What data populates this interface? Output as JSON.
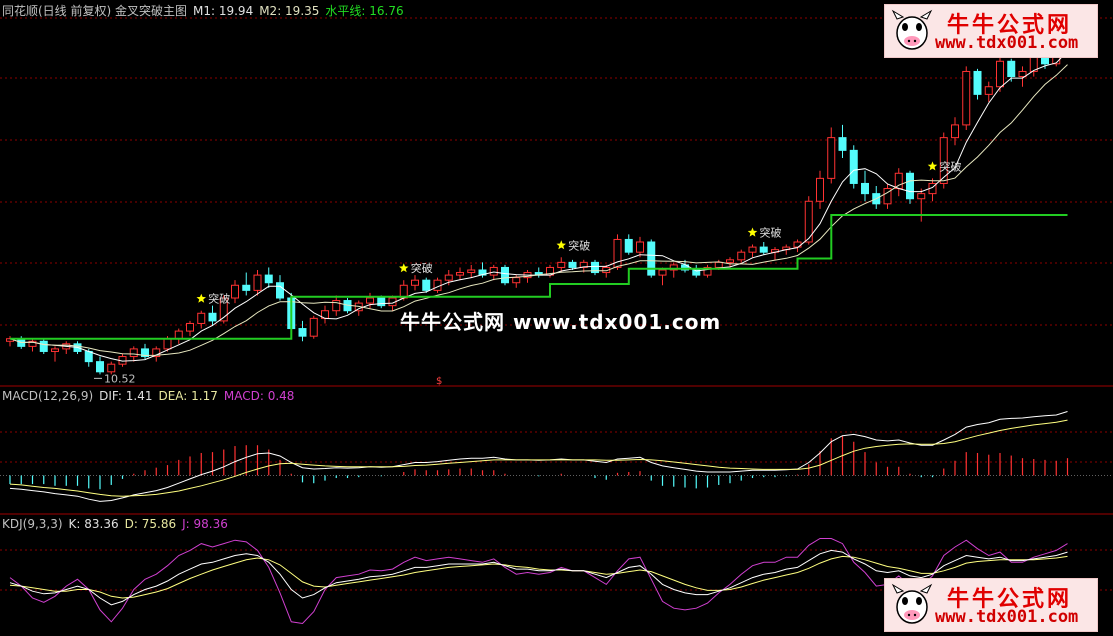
{
  "main_header": {
    "title": "同花顺(日线 前复权) 金叉突破主图",
    "m1": "M1: 19.94",
    "m2": "M2: 19.35",
    "level": "水平线: 16.76"
  },
  "macd_header": {
    "name": "MACD(12,26,9)",
    "dif": "DIF: 1.41",
    "dea": "DEA: 1.17",
    "macd": "MACD: 0.48"
  },
  "kdj_header": {
    "name": "KDJ(9,3,3)",
    "k": "K: 83.36",
    "d": "D: 75.86",
    "j": "J: 98.36"
  },
  "watermark": "牛牛公式网 www.tdx001.com",
  "logo": {
    "title": "牛牛公式网",
    "url": "www.tdx001.com"
  },
  "colors": {
    "up": "#ff3232",
    "down": "#54fcfc",
    "level": "#22cc22",
    "m1": "#ffffff",
    "m2": "#e8e8c0",
    "grid": "#8b0000",
    "dif": "#ffffff",
    "dea": "#ffff80",
    "j": "#d040d0",
    "star": "#ffff00"
  },
  "chart_data": [
    {
      "type": "candlestick",
      "low_label": "10.52",
      "signal_label": "突破",
      "signal_index": [
        17,
        35,
        49,
        66,
        82
      ],
      "ohlc": [
        [
          11.8,
          12.0,
          11.6,
          11.9
        ],
        [
          11.9,
          12.0,
          11.5,
          11.6
        ],
        [
          11.6,
          11.9,
          11.4,
          11.8
        ],
        [
          11.8,
          11.9,
          11.3,
          11.4
        ],
        [
          11.4,
          11.6,
          11.0,
          11.5
        ],
        [
          11.5,
          11.8,
          11.3,
          11.7
        ],
        [
          11.7,
          11.8,
          11.3,
          11.4
        ],
        [
          11.4,
          11.5,
          10.8,
          11.0
        ],
        [
          11.0,
          11.2,
          10.5,
          10.6
        ],
        [
          10.6,
          11.0,
          10.5,
          10.9
        ],
        [
          10.9,
          11.3,
          10.8,
          11.2
        ],
        [
          11.2,
          11.6,
          11.0,
          11.5
        ],
        [
          11.5,
          11.7,
          11.1,
          11.2
        ],
        [
          11.2,
          11.6,
          11.0,
          11.5
        ],
        [
          11.5,
          12.0,
          11.4,
          11.9
        ],
        [
          11.9,
          12.3,
          11.7,
          12.2
        ],
        [
          12.2,
          12.6,
          12.0,
          12.5
        ],
        [
          12.5,
          13.0,
          12.3,
          12.9
        ],
        [
          12.9,
          13.2,
          12.4,
          12.6
        ],
        [
          12.6,
          13.6,
          12.5,
          13.5
        ],
        [
          13.5,
          14.2,
          13.3,
          14.0
        ],
        [
          14.0,
          14.5,
          13.6,
          13.8
        ],
        [
          13.8,
          14.6,
          13.6,
          14.4
        ],
        [
          14.4,
          14.7,
          13.9,
          14.1
        ],
        [
          14.1,
          14.4,
          13.4,
          13.5
        ],
        [
          13.5,
          13.7,
          12.2,
          12.3
        ],
        [
          12.3,
          12.6,
          11.8,
          12.0
        ],
        [
          12.0,
          12.8,
          11.9,
          12.7
        ],
        [
          12.7,
          13.2,
          12.5,
          13.0
        ],
        [
          13.0,
          13.6,
          12.8,
          13.4
        ],
        [
          13.4,
          13.5,
          12.9,
          13.0
        ],
        [
          13.0,
          13.4,
          12.8,
          13.3
        ],
        [
          13.3,
          13.7,
          13.1,
          13.5
        ],
        [
          13.5,
          13.6,
          13.1,
          13.2
        ],
        [
          13.2,
          13.6,
          13.0,
          13.5
        ],
        [
          13.5,
          14.2,
          13.4,
          14.0
        ],
        [
          14.0,
          14.4,
          13.8,
          14.2
        ],
        [
          14.2,
          14.3,
          13.7,
          13.8
        ],
        [
          13.8,
          14.3,
          13.7,
          14.2
        ],
        [
          14.2,
          14.6,
          14.0,
          14.4
        ],
        [
          14.4,
          14.7,
          14.2,
          14.5
        ],
        [
          14.5,
          14.8,
          14.3,
          14.6
        ],
        [
          14.6,
          14.9,
          14.3,
          14.4
        ],
        [
          14.4,
          14.8,
          14.2,
          14.7
        ],
        [
          14.7,
          14.8,
          14.0,
          14.1
        ],
        [
          14.1,
          14.4,
          13.9,
          14.3
        ],
        [
          14.3,
          14.6,
          14.1,
          14.5
        ],
        [
          14.5,
          14.7,
          14.3,
          14.4
        ],
        [
          14.4,
          14.8,
          14.3,
          14.7
        ],
        [
          14.7,
          15.1,
          14.5,
          14.9
        ],
        [
          14.9,
          15.0,
          14.6,
          14.7
        ],
        [
          14.7,
          15.0,
          14.5,
          14.9
        ],
        [
          14.9,
          15.0,
          14.4,
          14.5
        ],
        [
          14.5,
          14.8,
          14.3,
          14.7
        ],
        [
          14.7,
          16.0,
          14.6,
          15.8
        ],
        [
          15.8,
          16.0,
          15.2,
          15.3
        ],
        [
          15.3,
          15.9,
          15.1,
          15.7
        ],
        [
          15.7,
          15.8,
          14.3,
          14.4
        ],
        [
          14.4,
          14.7,
          14.0,
          14.6
        ],
        [
          14.6,
          14.9,
          14.3,
          14.8
        ],
        [
          14.8,
          15.0,
          14.5,
          14.6
        ],
        [
          14.6,
          14.8,
          14.3,
          14.4
        ],
        [
          14.4,
          14.8,
          14.3,
          14.7
        ],
        [
          14.7,
          15.0,
          14.6,
          14.9
        ],
        [
          14.9,
          15.1,
          14.7,
          15.0
        ],
        [
          15.0,
          15.4,
          14.9,
          15.3
        ],
        [
          15.3,
          15.6,
          15.1,
          15.5
        ],
        [
          15.5,
          15.7,
          15.2,
          15.3
        ],
        [
          15.3,
          15.5,
          15.0,
          15.4
        ],
        [
          15.4,
          15.6,
          15.2,
          15.5
        ],
        [
          15.5,
          15.8,
          15.3,
          15.7
        ],
        [
          15.7,
          17.5,
          15.6,
          17.3
        ],
        [
          17.3,
          18.5,
          17.0,
          18.2
        ],
        [
          18.2,
          20.2,
          18.0,
          19.8
        ],
        [
          19.8,
          20.3,
          19.0,
          19.3
        ],
        [
          19.3,
          19.5,
          17.8,
          18.0
        ],
        [
          18.0,
          18.5,
          17.3,
          17.6
        ],
        [
          17.6,
          17.9,
          17.0,
          17.2
        ],
        [
          17.2,
          18.0,
          17.0,
          17.8
        ],
        [
          17.8,
          18.6,
          17.5,
          18.4
        ],
        [
          18.4,
          18.5,
          17.2,
          17.4
        ],
        [
          17.4,
          17.8,
          16.5,
          17.6
        ],
        [
          17.6,
          18.2,
          17.3,
          18.0
        ],
        [
          18.0,
          20.0,
          17.8,
          19.8
        ],
        [
          19.8,
          20.6,
          19.5,
          20.3
        ],
        [
          20.3,
          22.6,
          20.1,
          22.4
        ],
        [
          22.4,
          22.5,
          21.3,
          21.5
        ],
        [
          21.5,
          22.0,
          21.2,
          21.8
        ],
        [
          21.8,
          23.0,
          21.6,
          22.8
        ],
        [
          22.8,
          22.9,
          22.0,
          22.2
        ],
        [
          22.2,
          22.6,
          21.8,
          22.4
        ],
        [
          22.4,
          23.2,
          22.2,
          23.0
        ],
        [
          23.0,
          23.6,
          22.5,
          22.7
        ],
        [
          22.7,
          23.5,
          22.6,
          23.4
        ],
        [
          23.4,
          25.0,
          23.2,
          24.5
        ]
      ],
      "level_steps": [
        [
          0,
          11.9
        ],
        [
          25,
          13.55
        ],
        [
          48,
          14.05
        ],
        [
          55,
          14.65
        ],
        [
          70,
          15.05
        ],
        [
          73,
          16.76
        ]
      ],
      "ylim": [
        10.2,
        24.5
      ]
    },
    {
      "type": "macd",
      "dif": [
        -0.3,
        -0.32,
        -0.35,
        -0.38,
        -0.42,
        -0.45,
        -0.48,
        -0.55,
        -0.6,
        -0.58,
        -0.52,
        -0.45,
        -0.4,
        -0.35,
        -0.28,
        -0.18,
        -0.08,
        0.02,
        0.1,
        0.2,
        0.32,
        0.42,
        0.5,
        0.52,
        0.45,
        0.3,
        0.18,
        0.15,
        0.16,
        0.18,
        0.17,
        0.18,
        0.2,
        0.19,
        0.2,
        0.25,
        0.3,
        0.3,
        0.32,
        0.35,
        0.38,
        0.4,
        0.4,
        0.42,
        0.38,
        0.36,
        0.36,
        0.35,
        0.36,
        0.38,
        0.36,
        0.36,
        0.33,
        0.3,
        0.38,
        0.4,
        0.42,
        0.3,
        0.22,
        0.18,
        0.14,
        0.1,
        0.08,
        0.08,
        0.08,
        0.1,
        0.12,
        0.12,
        0.12,
        0.13,
        0.15,
        0.3,
        0.52,
        0.78,
        0.92,
        0.95,
        0.9,
        0.82,
        0.8,
        0.82,
        0.75,
        0.7,
        0.7,
        0.82,
        0.95,
        1.12,
        1.18,
        1.22,
        1.3,
        1.32,
        1.33,
        1.36,
        1.38,
        1.4,
        1.48
      ],
      "dea": [
        -0.2,
        -0.22,
        -0.25,
        -0.28,
        -0.3,
        -0.33,
        -0.36,
        -0.4,
        -0.44,
        -0.47,
        -0.48,
        -0.47,
        -0.46,
        -0.44,
        -0.4,
        -0.36,
        -0.3,
        -0.24,
        -0.17,
        -0.1,
        -0.02,
        0.07,
        0.15,
        0.22,
        0.27,
        0.28,
        0.26,
        0.24,
        0.22,
        0.21,
        0.2,
        0.2,
        0.2,
        0.2,
        0.2,
        0.21,
        0.23,
        0.24,
        0.26,
        0.28,
        0.3,
        0.32,
        0.34,
        0.36,
        0.36,
        0.36,
        0.36,
        0.36,
        0.36,
        0.36,
        0.36,
        0.36,
        0.36,
        0.35,
        0.35,
        0.36,
        0.37,
        0.36,
        0.34,
        0.31,
        0.28,
        0.25,
        0.22,
        0.19,
        0.17,
        0.16,
        0.15,
        0.14,
        0.14,
        0.14,
        0.14,
        0.17,
        0.24,
        0.35,
        0.46,
        0.56,
        0.63,
        0.67,
        0.7,
        0.72,
        0.73,
        0.72,
        0.72,
        0.74,
        0.78,
        0.85,
        0.92,
        0.98,
        1.04,
        1.09,
        1.13,
        1.17,
        1.2,
        1.23,
        1.28
      ],
      "ylim": [
        -0.8,
        1.7
      ]
    },
    {
      "type": "kdj",
      "k": [
        48,
        44,
        38,
        35,
        36,
        40,
        44,
        40,
        30,
        22,
        26,
        34,
        40,
        44,
        50,
        58,
        64,
        70,
        72,
        76,
        80,
        82,
        80,
        72,
        58,
        40,
        30,
        34,
        42,
        48,
        50,
        52,
        55,
        56,
        58,
        62,
        66,
        66,
        68,
        70,
        70,
        70,
        70,
        72,
        68,
        64,
        64,
        62,
        62,
        64,
        62,
        62,
        58,
        54,
        60,
        66,
        68,
        58,
        46,
        40,
        36,
        34,
        34,
        38,
        42,
        48,
        54,
        58,
        60,
        64,
        66,
        74,
        82,
        86,
        84,
        76,
        70,
        62,
        60,
        62,
        56,
        54,
        58,
        68,
        74,
        80,
        78,
        76,
        78,
        74,
        74,
        76,
        78,
        80,
        84
      ],
      "d": [
        45,
        44,
        42,
        40,
        38,
        38,
        40,
        40,
        37,
        32,
        30,
        31,
        34,
        37,
        41,
        47,
        53,
        58,
        63,
        67,
        71,
        75,
        77,
        75,
        69,
        59,
        49,
        44,
        43,
        45,
        47,
        49,
        51,
        53,
        55,
        57,
        60,
        62,
        64,
        66,
        67,
        68,
        69,
        70,
        69,
        67,
        66,
        64,
        63,
        63,
        62,
        62,
        60,
        58,
        59,
        61,
        63,
        61,
        56,
        51,
        46,
        42,
        39,
        39,
        40,
        43,
        47,
        51,
        54,
        57,
        60,
        65,
        71,
        76,
        79,
        78,
        75,
        71,
        67,
        65,
        62,
        59,
        59,
        62,
        66,
        71,
        73,
        74,
        75,
        75,
        75,
        75,
        76,
        77,
        79
      ],
      "j": [
        54,
        44,
        30,
        25,
        32,
        44,
        52,
        40,
        16,
        2,
        18,
        40,
        52,
        58,
        68,
        80,
        86,
        94,
        90,
        94,
        98,
        96,
        86,
        66,
        36,
        2,
        0,
        14,
        40,
        54,
        56,
        58,
        63,
        62,
        64,
        72,
        78,
        74,
        76,
        78,
        76,
        74,
        72,
        76,
        66,
        58,
        60,
        58,
        60,
        66,
        62,
        62,
        54,
        46,
        62,
        76,
        78,
        52,
        26,
        18,
        16,
        18,
        24,
        36,
        46,
        58,
        68,
        72,
        72,
        78,
        78,
        92,
        100,
        100,
        94,
        72,
        60,
        44,
        46,
        56,
        44,
        44,
        56,
        80,
        90,
        98,
        88,
        80,
        84,
        72,
        72,
        78,
        82,
        86,
        94
      ],
      "ylim": [
        -10,
        110
      ]
    }
  ]
}
